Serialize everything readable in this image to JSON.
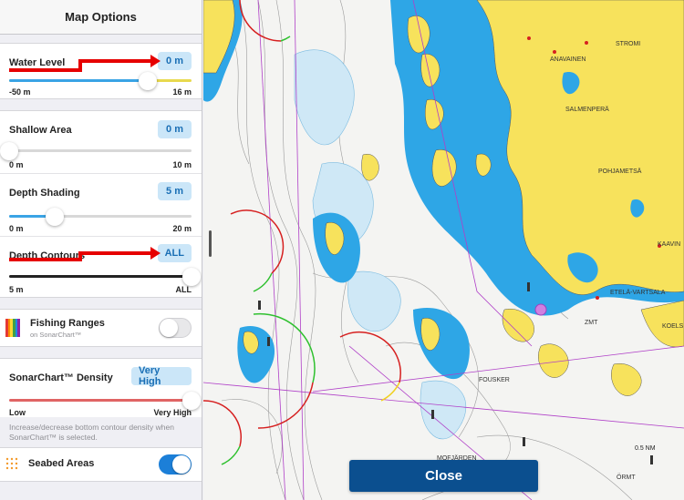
{
  "panel": {
    "title": "Map Options",
    "water_level": {
      "label": "Water Level",
      "value": "0 m",
      "min": "-50 m",
      "max": "16 m",
      "level": 0.76
    },
    "shallow_area": {
      "label": "Shallow Area",
      "value": "0 m",
      "min": "0 m",
      "max": "10 m",
      "level": 0.0
    },
    "depth_shading": {
      "label": "Depth Shading",
      "value": "5 m",
      "min": "0 m",
      "max": "20 m",
      "level": 0.25
    },
    "depth_contours": {
      "label": "Depth Contours",
      "value": "ALL",
      "min": "5 m",
      "max": "ALL",
      "level": 1.0
    },
    "fishing_ranges": {
      "label": "Fishing Ranges",
      "sublabel": "on SonarChart™",
      "enabled": false
    },
    "sonarchart_density": {
      "label": "SonarChart™ Density",
      "value": "Very High",
      "min": "Low",
      "max": "Very High",
      "level": 1.0,
      "note": "Increase/decrease bottom contour density when SonarChart™ is selected."
    },
    "seabed_areas": {
      "label": "Seabed Areas",
      "enabled": true
    }
  },
  "map": {
    "places": [
      "ANAVAINEN",
      "STROMI",
      "SALMENPERÄ",
      "POHJAMETSÄ",
      "KAAVIN",
      "ETELÄ-VARTSALA",
      "ZMT",
      "KOELS",
      "FOUSKER",
      "MOFJÄRDEN",
      "ÖRMT"
    ],
    "scale_label": "0.5 NM"
  },
  "close_label": "Close",
  "colors": {
    "accent": "#1c7fd8",
    "pill_bg": "#cbe6f8",
    "land": "#f7e25c",
    "shallow_water": "#2ea6e6",
    "close_button": "#0b4f8f",
    "annotation": "#e60000"
  }
}
